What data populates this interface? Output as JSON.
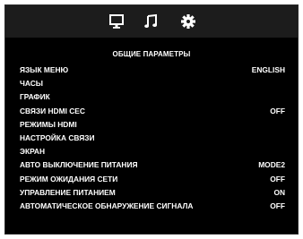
{
  "tabs": [
    {
      "icon": "monitor-icon"
    },
    {
      "icon": "music-note-icon"
    },
    {
      "icon": "gear-icon"
    }
  ],
  "title": "ОБЩИЕ ПАРАМЕТРЫ",
  "menu": [
    {
      "label": "ЯЗЫК МЕНЮ",
      "value": "ENGLISH"
    },
    {
      "label": "ЧАСЫ",
      "value": ""
    },
    {
      "label": "ГРАФИК",
      "value": ""
    },
    {
      "label": "СВЯЗИ HDMI CEC",
      "value": "OFF"
    },
    {
      "label": "РЕЖИМЫ HDMI",
      "value": ""
    },
    {
      "label": "НАСТРОЙКА СВЯЗИ",
      "value": ""
    },
    {
      "label": "ЭКРАН",
      "value": ""
    },
    {
      "label": "АВТО ВЫКЛЮЧЕНИЕ ПИТАНИЯ",
      "value": "MODE2"
    },
    {
      "label": "РЕЖИМ ОЖИДАНИЯ СЕТИ",
      "value": "OFF"
    },
    {
      "label": "УПРАВЛЕНИЕ ПИТАНИЕМ",
      "value": "ON"
    },
    {
      "label": "АВТОМАТИЧЕСКОЕ ОБНАРУЖЕНИЕ СИГНАЛА",
      "value": "OFF"
    }
  ],
  "colors": {
    "background": "#000000",
    "topbar": "#1c1c1c",
    "text": "#ffffff"
  }
}
